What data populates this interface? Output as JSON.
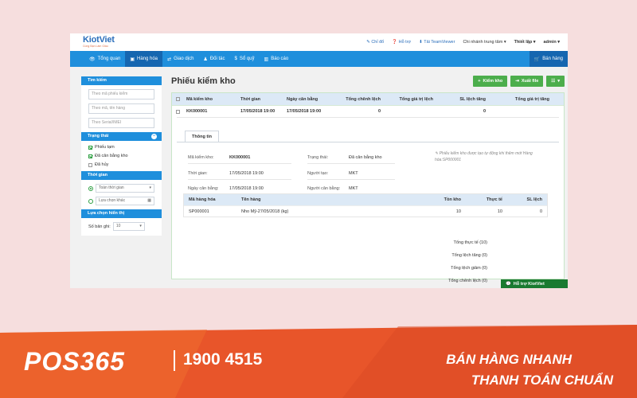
{
  "colors": {
    "nav": "#1f8fdc",
    "nav_active": "#1566b0",
    "success": "#4cae4c",
    "banner": "#e8552a"
  },
  "topbar": {
    "logo": "KiotViet",
    "logo_tagline": "Cùng Bạn Làm Giàu",
    "links": [
      "Chỉ đổ",
      "Hỗ trợ",
      "Tải TeamViewer"
    ],
    "branch": "Chi nhánh trung tâm",
    "settings": "Thiết lập",
    "user": "admin"
  },
  "nav": {
    "items": [
      {
        "label": "Tổng quan",
        "icon": "eye-icon"
      },
      {
        "label": "Hàng hóa",
        "icon": "box-icon"
      },
      {
        "label": "Giao dịch",
        "icon": "exchange-icon"
      },
      {
        "label": "Đối tác",
        "icon": "person-icon"
      },
      {
        "label": "Sổ quỹ",
        "icon": "dollar-icon"
      },
      {
        "label": "Báo cáo",
        "icon": "chart-icon"
      }
    ],
    "sell": "Bán hàng"
  },
  "sidebar": {
    "search_title": "Tìm kiếm",
    "search_fields": [
      "Theo mã phiếu kiểm",
      "Theo mã, tên hàng",
      "Theo Serial/IMEI"
    ],
    "status_title": "Trạng thái",
    "statuses": [
      {
        "label": "Phiếu tạm",
        "checked": true
      },
      {
        "label": "Đã cân bằng kho",
        "checked": true
      },
      {
        "label": "Đã hủy",
        "checked": false
      }
    ],
    "time_title": "Thời gian",
    "time_all": "Toàn thời gian",
    "time_custom": "Lựa chọn khác",
    "display_title": "Lựa chọn hiển thị",
    "records_label": "Số bản ghi:",
    "records_value": "10"
  },
  "main": {
    "title": "Phiếu kiểm kho",
    "btn_add": "Kiểm kho",
    "btn_export": "Xuất file",
    "columns": [
      "Mã kiểm kho",
      "Thời gian",
      "Ngày cân bằng",
      "Tổng chênh lệch",
      "Tổng giá trị lệch",
      "SL lệch tăng",
      "Tổng giá trị tăng"
    ],
    "row": {
      "code": "KK000001",
      "time": "17/05/2018 19:00",
      "balance_date": "17/05/2018 19:00",
      "total_diff": "0",
      "total_diff_value": "",
      "qty_increase": "0",
      "value_increase": ""
    }
  },
  "detail": {
    "tab": "Thông tin",
    "labels": {
      "code": "Mã kiểm kho:",
      "time": "Thời gian:",
      "balance": "Ngày cân bằng:",
      "status": "Trạng thái:",
      "creator": "Người tạo:",
      "balancer": "Người cân bằng:"
    },
    "values": {
      "code": "KK000001",
      "time": "17/05/2018 19:00",
      "balance": "17/05/2018 19:00",
      "status": "Đã cân bằng kho",
      "creator": "MKT",
      "balancer": "MKT"
    },
    "note": "Phiếu kiểm kho được tạo tự động khi thêm mới Hàng hóa:SP000001",
    "items_columns": [
      "Mã hàng hóa",
      "Tên hàng",
      "Tồn kho",
      "Thực tế",
      "SL lệch"
    ],
    "items": [
      {
        "code": "SP000001",
        "name": "Nho Mỹ-27/05/2018 (kg)",
        "stock": "10",
        "actual": "10",
        "diff": "0"
      }
    ],
    "totals": [
      "Tổng thực tế (10)",
      "Tổng lệch tăng (0)",
      "Tổng lệch giảm (0)",
      "Tổng chênh lệch (0)"
    ]
  },
  "support": "Hỗ trợ KiotViet",
  "banner": {
    "logo": "POS365",
    "phone": "1900 4515",
    "slogan_1": "BÁN HÀNG NHANH",
    "slogan_2": "THANH TOÁN CHUẨN"
  }
}
